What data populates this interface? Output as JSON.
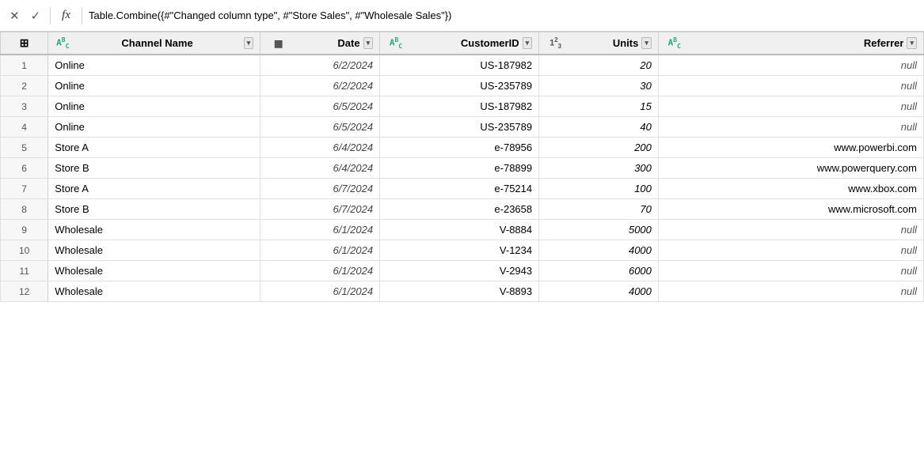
{
  "formulaBar": {
    "closeLabel": "✕",
    "checkLabel": "✓",
    "fxLabel": "fx",
    "formula": "Table.Combine({#\"Changed column type\", #\"Store Sales\", #\"Wholesale Sales\"})"
  },
  "columns": [
    {
      "id": "channel",
      "label": "Channel Name",
      "typeIcon": "ABC",
      "typeSymbol": "Ā"
    },
    {
      "id": "date",
      "label": "Date",
      "typeIcon": "CAL",
      "typeSymbol": "📅"
    },
    {
      "id": "customerid",
      "label": "CustomerID",
      "typeIcon": "ABC",
      "typeSymbol": "Ā"
    },
    {
      "id": "units",
      "label": "Units",
      "typeIcon": "123",
      "typeSymbol": "1²₃"
    },
    {
      "id": "referrer",
      "label": "Referrer",
      "typeIcon": "ABC",
      "typeSymbol": "Ā"
    }
  ],
  "rows": [
    {
      "num": 1,
      "channel": "Online",
      "date": "6/2/2024",
      "customerid": "US-187982",
      "units": "20",
      "referrer": "null"
    },
    {
      "num": 2,
      "channel": "Online",
      "date": "6/2/2024",
      "customerid": "US-235789",
      "units": "30",
      "referrer": "null"
    },
    {
      "num": 3,
      "channel": "Online",
      "date": "6/5/2024",
      "customerid": "US-187982",
      "units": "15",
      "referrer": "null"
    },
    {
      "num": 4,
      "channel": "Online",
      "date": "6/5/2024",
      "customerid": "US-235789",
      "units": "40",
      "referrer": "null"
    },
    {
      "num": 5,
      "channel": "Store A",
      "date": "6/4/2024",
      "customerid": "e-78956",
      "units": "200",
      "referrer": "www.powerbi.com"
    },
    {
      "num": 6,
      "channel": "Store B",
      "date": "6/4/2024",
      "customerid": "e-78899",
      "units": "300",
      "referrer": "www.powerquery.com"
    },
    {
      "num": 7,
      "channel": "Store A",
      "date": "6/7/2024",
      "customerid": "e-75214",
      "units": "100",
      "referrer": "www.xbox.com"
    },
    {
      "num": 8,
      "channel": "Store B",
      "date": "6/7/2024",
      "customerid": "e-23658",
      "units": "70",
      "referrer": "www.microsoft.com"
    },
    {
      "num": 9,
      "channel": "Wholesale",
      "date": "6/1/2024",
      "customerid": "V-8884",
      "units": "5000",
      "referrer": "null"
    },
    {
      "num": 10,
      "channel": "Wholesale",
      "date": "6/1/2024",
      "customerid": "V-1234",
      "units": "4000",
      "referrer": "null"
    },
    {
      "num": 11,
      "channel": "Wholesale",
      "date": "6/1/2024",
      "customerid": "V-2943",
      "units": "6000",
      "referrer": "null"
    },
    {
      "num": 12,
      "channel": "Wholesale",
      "date": "6/1/2024",
      "customerid": "V-8893",
      "units": "4000",
      "referrer": "null"
    }
  ]
}
